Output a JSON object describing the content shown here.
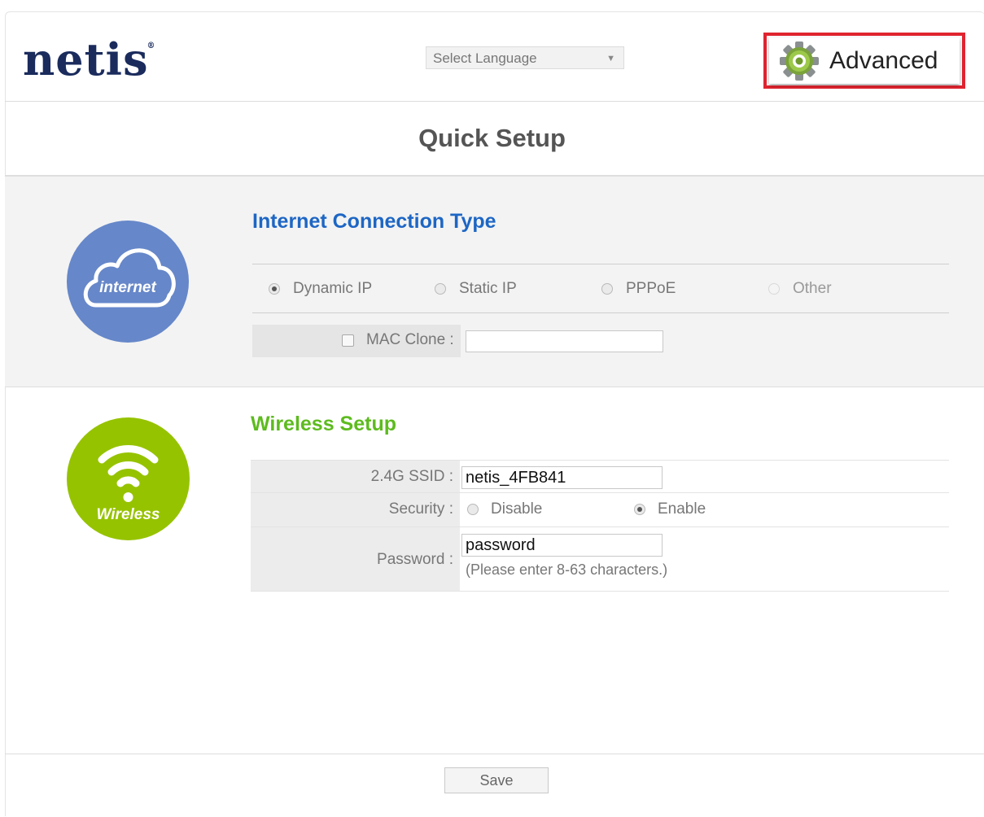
{
  "header": {
    "logo": "netis",
    "logo_mark": "®",
    "language_select": {
      "value": "Select Language"
    },
    "advanced_button": {
      "label": "Advanced",
      "icon": "gear-icon"
    }
  },
  "page_title": "Quick Setup",
  "internet": {
    "icon_label": "internet",
    "title": "Internet Connection Type",
    "options": [
      {
        "label": "Dynamic IP",
        "checked": true,
        "enabled": true
      },
      {
        "label": "Static IP",
        "checked": false,
        "enabled": true
      },
      {
        "label": "PPPoE",
        "checked": false,
        "enabled": true
      },
      {
        "label": "Other",
        "checked": false,
        "enabled": false
      }
    ],
    "mac_clone": {
      "label": "MAC Clone :",
      "checked": false,
      "value": ""
    }
  },
  "wireless": {
    "icon_label": "Wireless",
    "title": "Wireless Setup",
    "ssid": {
      "label": "2.4G SSID :",
      "value": "netis_4FB841"
    },
    "security": {
      "label": "Security :",
      "options": [
        {
          "label": "Disable",
          "checked": false
        },
        {
          "label": "Enable",
          "checked": true
        }
      ]
    },
    "password": {
      "label": "Password :",
      "value": "password",
      "hint": "(Please enter 8-63 characters.)"
    }
  },
  "footer": {
    "save_label": "Save"
  },
  "colors": {
    "accent_blue": "#1d66c4",
    "accent_green": "#5dbb1e",
    "highlight_red": "#e0242f",
    "logo_navy": "#1a2b5c"
  }
}
